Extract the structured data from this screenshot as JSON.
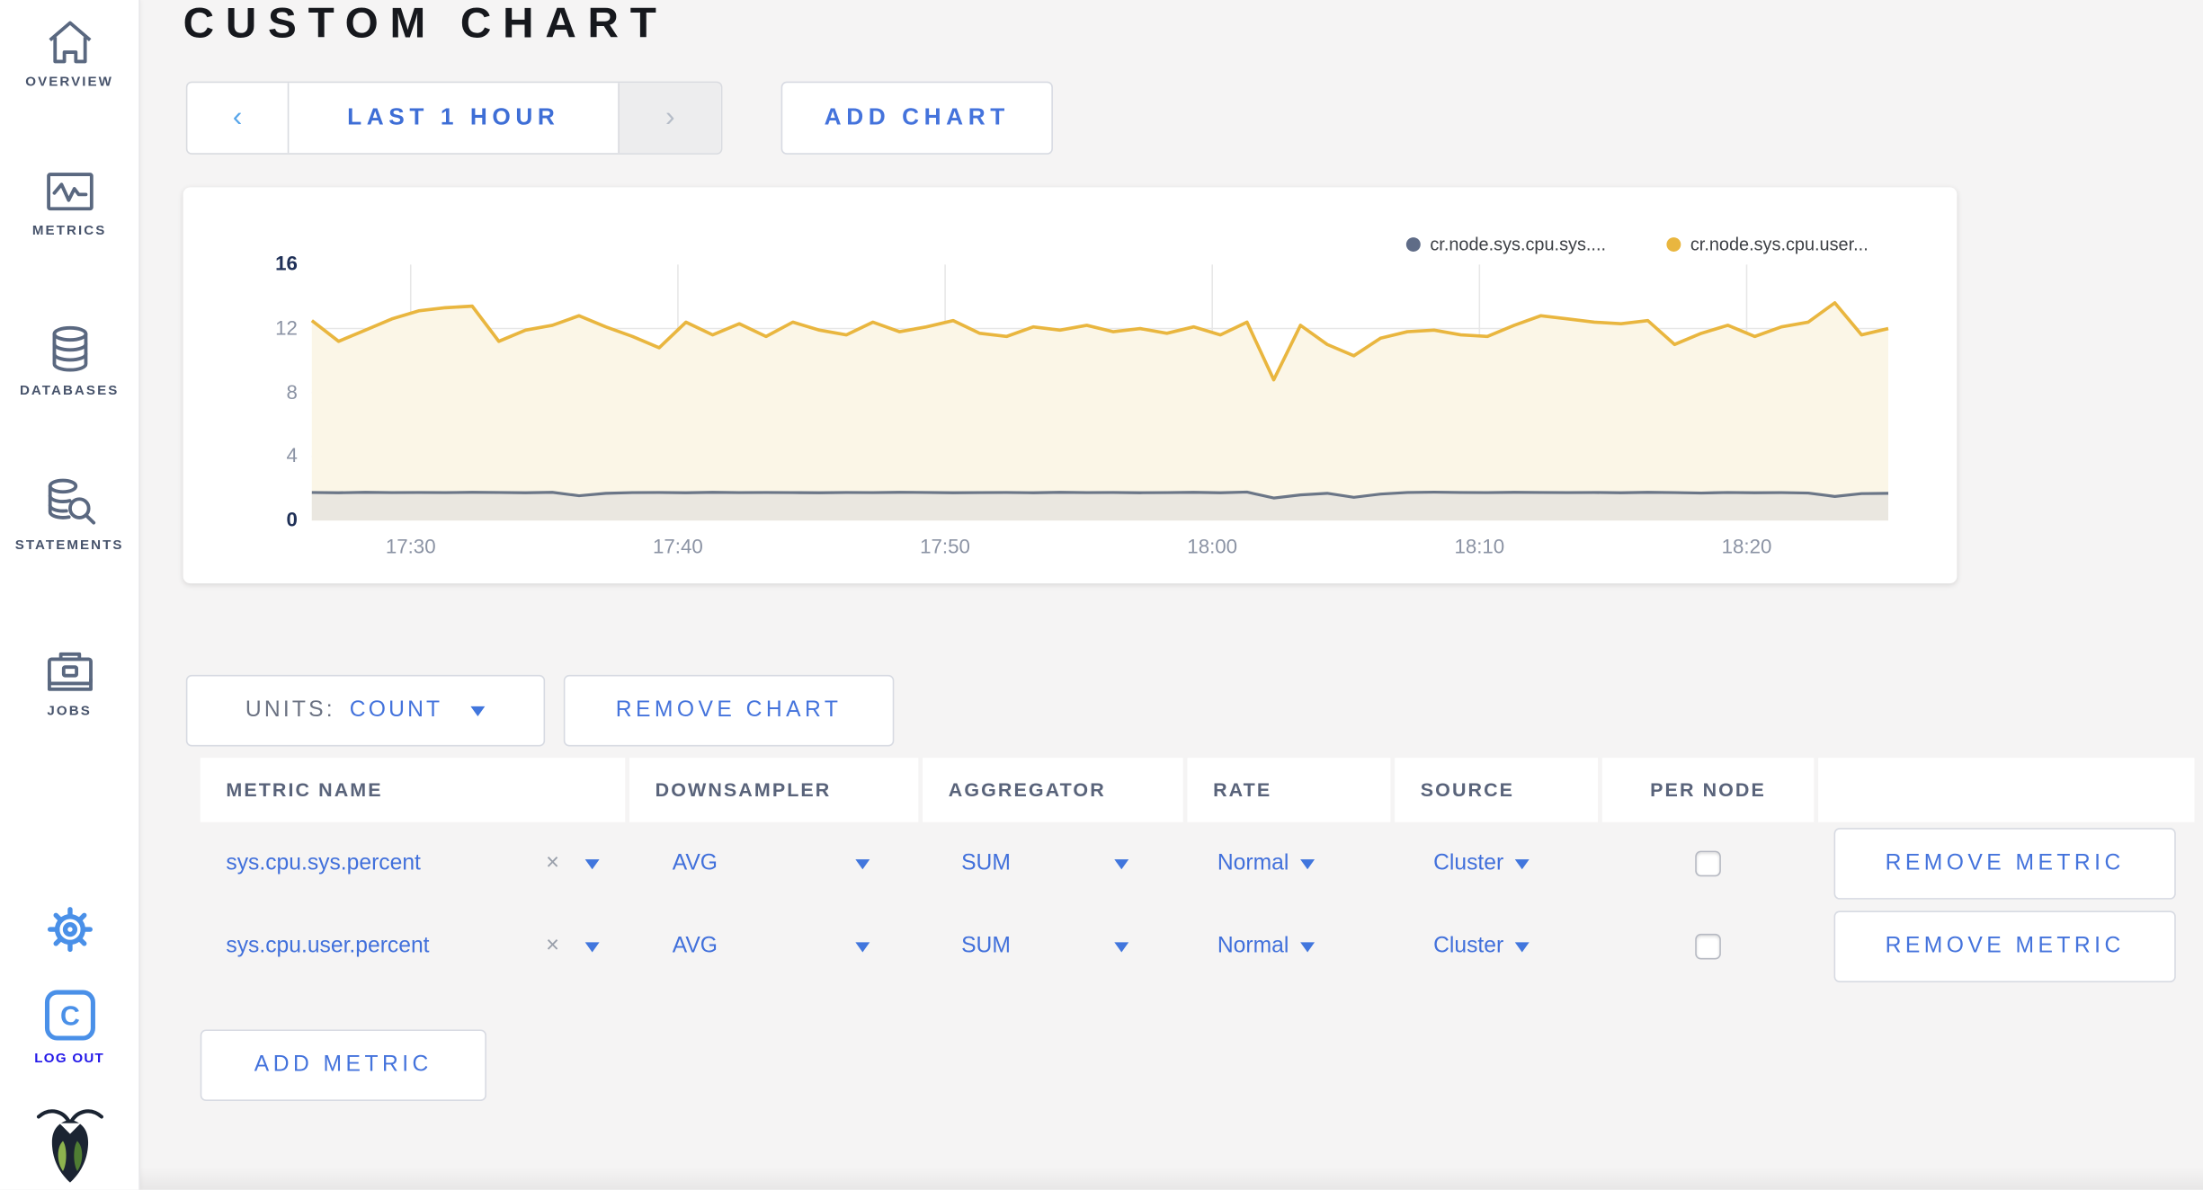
{
  "sidebar": {
    "items": [
      {
        "label": "OVERVIEW",
        "icon": "home-icon"
      },
      {
        "label": "METRICS",
        "icon": "metrics-icon"
      },
      {
        "label": "DATABASES",
        "icon": "database-icon"
      },
      {
        "label": "STATEMENTS",
        "icon": "statements-icon"
      },
      {
        "label": "JOBS",
        "icon": "jobs-icon"
      }
    ],
    "logout_label": "LOG OUT"
  },
  "header": {
    "title": "CUSTOM CHART"
  },
  "toolbar": {
    "prev_icon": "‹",
    "next_icon": "›",
    "time_range_label": "LAST 1 HOUR",
    "add_chart_label": "ADD CHART"
  },
  "chart_data": {
    "type": "line",
    "x_tick_labels": [
      "17:30",
      "17:40",
      "17:50",
      "18:00",
      "18:10",
      "18:20"
    ],
    "x_range": [
      "17:26",
      "18:26"
    ],
    "y_ticks": [
      0,
      4,
      8,
      12,
      16
    ],
    "ylim": [
      0,
      16
    ],
    "grid": true,
    "legend_position": "top-right",
    "series": [
      {
        "name": "cr.node.sys.cpu.sys....",
        "color": "#5f6c87",
        "fill": "#eae7e0",
        "values": [
          1.75,
          1.73,
          1.76,
          1.74,
          1.75,
          1.74,
          1.76,
          1.75,
          1.73,
          1.76,
          1.55,
          1.7,
          1.74,
          1.75,
          1.73,
          1.76,
          1.74,
          1.75,
          1.74,
          1.73,
          1.75,
          1.74,
          1.76,
          1.75,
          1.73,
          1.74,
          1.75,
          1.73,
          1.76,
          1.74,
          1.75,
          1.73,
          1.74,
          1.76,
          1.73,
          1.78,
          1.4,
          1.6,
          1.7,
          1.45,
          1.65,
          1.75,
          1.77,
          1.75,
          1.74,
          1.76,
          1.75,
          1.74,
          1.75,
          1.73,
          1.76,
          1.74,
          1.72,
          1.75,
          1.73,
          1.74,
          1.72,
          1.5,
          1.68,
          1.7
        ]
      },
      {
        "name": "cr.node.sys.cpu.user...",
        "color": "#e9b63f",
        "fill": "#fbf6e7",
        "values": [
          12.5,
          11.2,
          11.9,
          12.6,
          13.1,
          13.3,
          13.4,
          11.2,
          11.9,
          12.2,
          12.8,
          12.1,
          11.5,
          10.8,
          12.4,
          11.6,
          12.3,
          11.5,
          12.4,
          11.9,
          11.6,
          12.4,
          11.8,
          12.1,
          12.5,
          11.7,
          11.5,
          12.1,
          11.9,
          12.2,
          11.8,
          12.0,
          11.7,
          12.1,
          11.6,
          12.4,
          8.8,
          12.2,
          11.0,
          10.3,
          11.4,
          11.8,
          11.9,
          11.6,
          11.5,
          12.2,
          12.8,
          12.6,
          12.4,
          12.3,
          12.5,
          11.0,
          11.7,
          12.2,
          11.5,
          12.1,
          12.4,
          13.6,
          11.6,
          12.0
        ]
      }
    ]
  },
  "chart_controls": {
    "units_label": "UNITS:",
    "units_value": "COUNT",
    "remove_chart_label": "REMOVE CHART"
  },
  "metrics_table": {
    "columns": [
      "METRIC NAME",
      "DOWNSAMPLER",
      "AGGREGATOR",
      "RATE",
      "SOURCE",
      "PER NODE",
      ""
    ],
    "rows": [
      {
        "metric": "sys.cpu.sys.percent",
        "clear": "×",
        "downsampler": "AVG",
        "aggregator": "SUM",
        "rate": "Normal",
        "source": "Cluster",
        "per_node_checked": false,
        "remove_label": "REMOVE METRIC"
      },
      {
        "metric": "sys.cpu.user.percent",
        "clear": "×",
        "downsampler": "AVG",
        "aggregator": "SUM",
        "rate": "Normal",
        "source": "Cluster",
        "per_node_checked": false,
        "remove_label": "REMOVE METRIC"
      }
    ],
    "add_metric_label": "ADD METRIC"
  },
  "colors": {
    "accent_blue": "#4473dc",
    "logout_blue": "#2318e8",
    "sidebar_icon": "#5a6880",
    "series_sys": "#5f6c87",
    "series_user": "#e9b63f",
    "tick_dark": "#1f3057",
    "tick_gray": "#8b93a4"
  }
}
